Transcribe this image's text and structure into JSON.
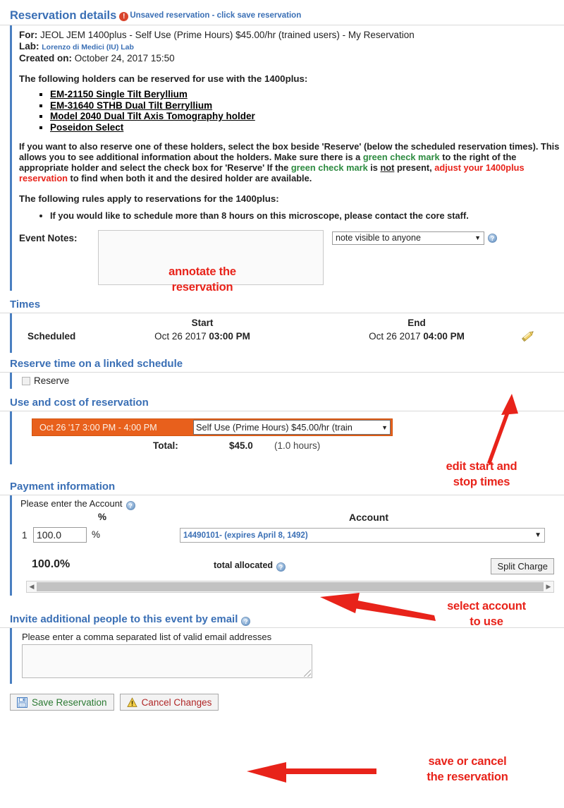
{
  "header": {
    "title": "Reservation details",
    "error_icon": "!",
    "unsaved_text": "Unsaved reservation - click save reservation"
  },
  "details": {
    "for_label": "For:",
    "for_value": "JEOL JEM 1400plus - Self Use (Prime Hours) $45.00/hr (trained users) - My Reservation",
    "lab_label": "Lab:",
    "lab_value": "Lorenzo di Medici (IU) Lab",
    "created_label": "Created on:",
    "created_value": "October 24, 2017 15:50",
    "holders_intro": "The following holders can be reserved for use with the 1400plus:",
    "holders": [
      "EM-21150 Single Tilt Beryllium",
      "EM-31640 STHB Dual Tilt Berryllium",
      "Model 2040 Dual Tilt Axis Tomography holder",
      "Poseidon Select"
    ],
    "explain_1": "If you want to also reserve one of these holders, select the box beside 'Reserve' (below the scheduled reservation times).  This allows you to see additional information about the holders.  Make sure there is a ",
    "explain_green_1": "green check mark",
    "explain_2": " to the right of the appropriate holder and select the check box for 'Reserve'    If the ",
    "explain_green_2": "green check mark",
    "explain_3": " is ",
    "explain_not": "not",
    "explain_4": " present, ",
    "explain_red": "adjust your 1400plus reservation",
    "explain_5": " to find when both it and the desired holder are available.",
    "rules_intro": "The following rules apply to reservations for the 1400plus:",
    "rules": [
      "If you would like to schedule more than 8 hours on this microscope, please contact the core staff."
    ]
  },
  "event_notes": {
    "label": "Event Notes:",
    "textarea_value": "",
    "visibility_selected": "note visible to anyone",
    "visibility_options": [
      "note visible to anyone"
    ],
    "help_icon": "?"
  },
  "times": {
    "heading": "Times",
    "col_row_label": "Scheduled",
    "col_start": "Start",
    "col_end": "End",
    "start_date": "Oct 26 2017 ",
    "start_time": "03:00 PM",
    "end_date": "Oct 26 2017 ",
    "end_time": "04:00 PM",
    "edit_icon": "pencil-icon"
  },
  "linked_schedule": {
    "heading": "Reserve time on a linked schedule",
    "reserve_label": "Reserve",
    "reserve_checked": false
  },
  "use_cost": {
    "heading": "Use and cost of reservation",
    "slot_range": "Oct 26 '17 3:00 PM - 4:00 PM",
    "rate_selected": "Self Use (Prime Hours) $45.00/hr (train",
    "rate_options": [
      "Self Use (Prime Hours) $45.00/hr (trained users)"
    ],
    "total_label": "Total:",
    "total_amount": "$45.0",
    "total_hours": "(1.0 hours)",
    "accent_color": "#e8601c"
  },
  "payment": {
    "heading": "Payment information",
    "hint": "Please enter the Account",
    "hint_help_icon": "?",
    "col_pct": "%",
    "col_account": "Account",
    "row_number": "1",
    "pct_value": "100.0",
    "pct_sign": "%",
    "account_selected": "14490101- (expires April 8, 1492)",
    "account_options": [
      "14490101- (expires April 8, 1492)"
    ],
    "total_allocated_pct": "100.0%",
    "total_allocated_label": "total allocated",
    "total_allocated_help_icon": "?",
    "split_charge_label": "Split Charge"
  },
  "invite": {
    "heading": "Invite additional people to this event by email",
    "heading_help_icon": "?",
    "hint": "Please enter a comma separated list of valid email addresses",
    "textarea_value": ""
  },
  "footer": {
    "save_label": "Save Reservation",
    "cancel_label": "Cancel Changes",
    "save_icon": "floppy-disk-icon",
    "cancel_icon": "warning-triangle-icon"
  },
  "annotations": {
    "notes": "annotate the\nreservation",
    "times": "edit start and\nstop times",
    "account": "select account\nto use",
    "footer": "save or cancel\nthe reservation",
    "color": "#e8231a"
  }
}
